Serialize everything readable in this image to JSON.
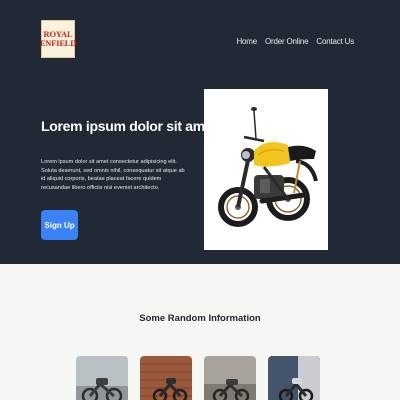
{
  "brand": {
    "logo_line1": "ROYAL",
    "logo_line2": "ENFIELD",
    "logo_color": "#c8251b"
  },
  "nav": {
    "items": [
      "Home",
      "Order Online",
      "Contact Us"
    ]
  },
  "hero": {
    "title": "Lorem ipsum dolor sit amet.",
    "text": "Lorem ipsum dolor sit amet consectetur adipisicing elit. Soluta deserunt, sed omnis nihil, consequatur sit atque ab id aliquid corporis, beatae placeat facere quidem recusandae libero officiis nisi eveniet architecto.",
    "signup_label": "Sign Up",
    "image": "yellow-motorcycle",
    "background": "#212937",
    "accent": "#3b82f6"
  },
  "section": {
    "title": "Some Random Information",
    "cards": [
      {
        "image": "motorcycle-photo-1"
      },
      {
        "image": "motorcycle-photo-2"
      },
      {
        "image": "motorcycle-photo-3"
      },
      {
        "image": "motorcycle-photo-4"
      }
    ]
  }
}
